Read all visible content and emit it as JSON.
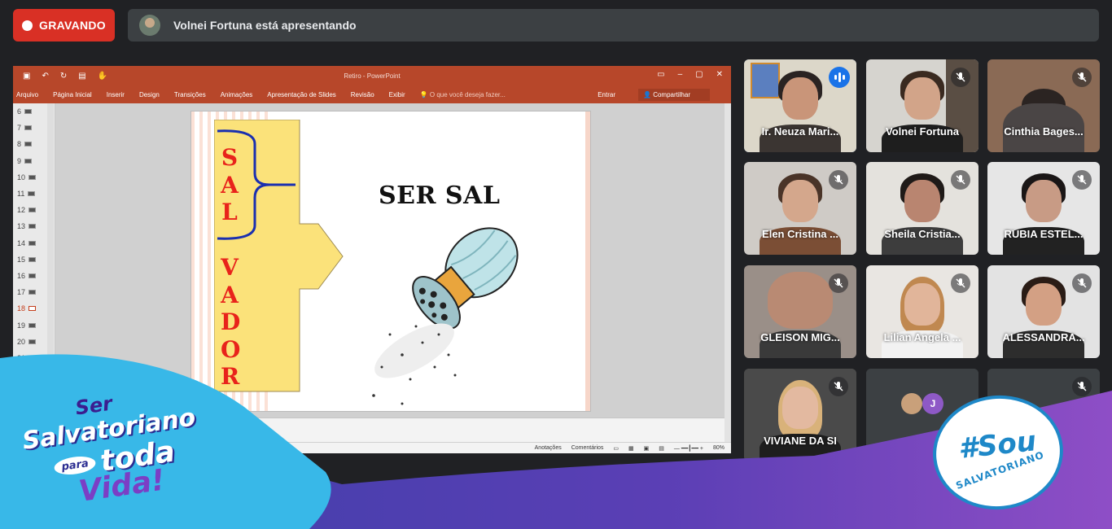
{
  "recording": {
    "label": "GRAVANDO"
  },
  "presentation_banner": {
    "text": "Volnei Fortuna está apresentando"
  },
  "powerpoint": {
    "doc_title": "Retiro - PowerPoint",
    "ribbon_tabs": [
      "Arquivo",
      "Página Inicial",
      "Inserir",
      "Design",
      "Transições",
      "Animações",
      "Apresentação de Slides",
      "Revisão",
      "Exibir"
    ],
    "tell_me": "O que você deseja fazer...",
    "sign_in": "Entrar",
    "share": "Compartilhar",
    "thumbnail_numbers": [
      "6",
      "7",
      "8",
      "9",
      "10",
      "11",
      "12",
      "13",
      "14",
      "15",
      "16",
      "17",
      "18",
      "19",
      "20",
      "21"
    ],
    "active_slide": "18",
    "status": {
      "notes": "Anotações",
      "comments": "Comentários",
      "zoom": "80%"
    },
    "slide": {
      "vertical_word_1": [
        "S",
        "A",
        "L"
      ],
      "vertical_word_2": [
        "V",
        "A",
        "D",
        "O",
        "R"
      ],
      "headline": "SER SAL"
    }
  },
  "participants": [
    {
      "name": "Ir. Neuza Mari...",
      "speaking": true,
      "muted": false
    },
    {
      "name": "Volnei Fortuna",
      "speaking": false,
      "muted": true
    },
    {
      "name": "Cinthia Bages...",
      "speaking": false,
      "muted": true
    },
    {
      "name": "Elen Cristina ...",
      "speaking": false,
      "muted": true
    },
    {
      "name": "Sheila Cristia...",
      "speaking": false,
      "muted": true
    },
    {
      "name": "RUBIA ESTEL...",
      "speaking": false,
      "muted": true
    },
    {
      "name": "GLEISON MIG...",
      "speaking": false,
      "muted": true
    },
    {
      "name": "Lilian Angela ...",
      "speaking": false,
      "muted": true
    },
    {
      "name": "ALESSANDRA...",
      "speaking": false,
      "muted": true
    },
    {
      "name": "VIVIANE DA SI",
      "speaking": false,
      "muted": true
    },
    {
      "name": "",
      "speaking": false,
      "muted": false,
      "avatar_letter": "J"
    },
    {
      "name": "",
      "speaking": false,
      "muted": true
    }
  ],
  "branding": {
    "left_line1": "Ser",
    "left_line2": "Salvatoriano",
    "left_para": "para",
    "left_toda": "toda",
    "left_vida": "Vida!",
    "right_hash": "#Sou",
    "right_salv": "SALVATORIANO"
  },
  "colors": {
    "accent": "#1a73e8",
    "record": "#d93025",
    "ppt": "#b7472a"
  }
}
